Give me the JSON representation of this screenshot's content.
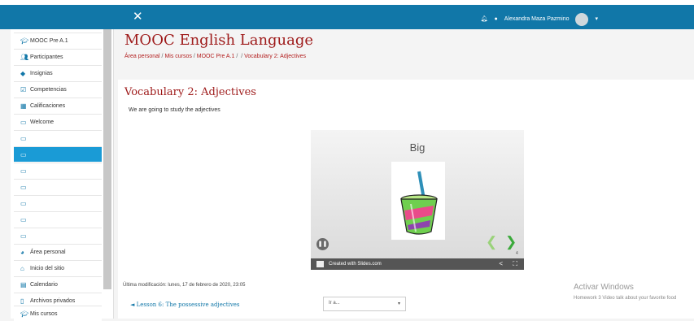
{
  "topbar": {
    "user_name": "Alexandra Maza Pazmino"
  },
  "sidebar": {
    "items": [
      {
        "label": "MOOC Pre A.1",
        "icon": "graduation-cap-icon"
      },
      {
        "label": "Participantes",
        "icon": "users-icon"
      },
      {
        "label": "Insignias",
        "icon": "shield-icon"
      },
      {
        "label": "Competencias",
        "icon": "check-square-icon"
      },
      {
        "label": "Calificaciones",
        "icon": "table-icon"
      },
      {
        "label": "Welcome",
        "icon": "folder-icon"
      },
      {
        "label": "",
        "icon": "folder-icon"
      },
      {
        "label": "",
        "icon": "folder-icon"
      },
      {
        "label": "",
        "icon": "folder-icon"
      },
      {
        "label": "",
        "icon": "folder-icon"
      },
      {
        "label": "",
        "icon": "folder-icon"
      },
      {
        "label": "",
        "icon": "folder-icon"
      },
      {
        "label": "",
        "icon": "folder-icon"
      },
      {
        "label": "Área personal",
        "icon": "dashboard-icon"
      },
      {
        "label": "Inicio del sitio",
        "icon": "home-icon"
      },
      {
        "label": "Calendario",
        "icon": "calendar-icon"
      },
      {
        "label": "Archivos privados",
        "icon": "file-icon"
      },
      {
        "label": "Mis cursos",
        "icon": "graduation-cap-icon"
      }
    ]
  },
  "main": {
    "course_title": "MOOC English Language",
    "breadcrumb": {
      "home": "Área personal",
      "my_courses": "Mis cursos",
      "course": "MOOC Pre A.1",
      "current": "Vocabulary 2: Adjectives"
    },
    "page_heading": "Vocabulary 2: Adjectives",
    "intro": "We are going to study the adjectives",
    "slide": {
      "word": "Big",
      "credit": "Created with Slides.com",
      "number": "4"
    },
    "last_modified": "Última modificación: lunes, 17 de febrero de 2020, 23:05",
    "prev_activity": "◄ Lesson 6: The possessive adjectives",
    "jump_to": "Ir a..."
  },
  "watermark": {
    "title": "Activar Windows",
    "subtitle": "Homework 3 Video talk about your favorite food"
  },
  "colors": {
    "topbar": "#1177a8",
    "active_item": "#1a9bd6",
    "heading": "#9e1a1a"
  }
}
